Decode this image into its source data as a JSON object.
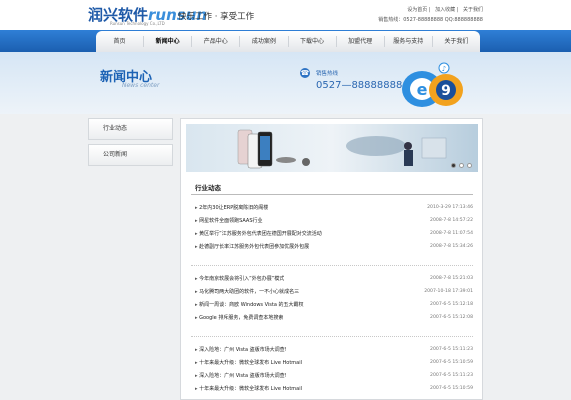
{
  "header": {
    "logo_cn": "润兴软件",
    "logo_en": "runsun",
    "logo_sub": "Runsun Technology Co.,LTD",
    "slogan": "快乐工作 · 享受工作",
    "toplinks": [
      "设为首页",
      "加入收藏",
      "关于我们"
    ],
    "hotline": "销售热线：0527-88888888  QQ:888888888"
  },
  "nav": {
    "items": [
      "首页",
      "新闻中心",
      "产品中心",
      "成功案例",
      "下载中心",
      "加盟代理",
      "服务与支持",
      "关于我们"
    ],
    "active_index": 1
  },
  "banner": {
    "title": "新闻中心",
    "subtitle": "News center",
    "hotline_label": "销售热线",
    "hotline_number": "0527—88888888"
  },
  "sidebar": {
    "items": [
      "行业动态",
      "公司新闻"
    ]
  },
  "main": {
    "section_title": "行业动态",
    "groups": [
      [
        {
          "title": "2年内30让ERP脱离陈旧的阁楼",
          "date": "2010-3-29 17:13:46"
        },
        {
          "title": "网星软件全面领跑SAAS行业",
          "date": "2008-7-8 14:57:22"
        },
        {
          "title": "黄区举行”江苏服务外包代表团在德国开展配对交流活动",
          "date": "2008-7-8 11:07:54"
        },
        {
          "title": "赴德副厅长率江苏服务外包代表团参加优展外包展",
          "date": "2008-7-8 15:34:26"
        }
      ],
      [
        {
          "title": "今年南京软展会将引入”外包办展”模式",
          "date": "2008-7-8 15:21:03"
        },
        {
          "title": "马化腾司两大助团的软件，一不小心就成名三",
          "date": "2007-10-18 17:39:01"
        },
        {
          "title": "新闻一周谈：商欧 Windows Vista 的五大霸权",
          "date": "2007-6-5 15:12:18"
        },
        {
          "title": "Google 排斥服务，免费调查本地搜索",
          "date": "2007-6-5 15:12:08"
        }
      ],
      [
        {
          "title": "深入险地：广州 Vista 盗版市场大调查!",
          "date": "2007-6-5 15:11:23"
        },
        {
          "title": "十年来最大升级：微软全球发布 Live Hotmail",
          "date": "2007-6-5 15:10:59"
        },
        {
          "title": "深入险地：广州 Vista 盗版市场大调查!",
          "date": "2007-6-5 15:11:23"
        },
        {
          "title": "十年来最大升级：微软全球发布 Live Hotmail",
          "date": "2007-6-5 15:10:59"
        }
      ]
    ]
  },
  "colors": {
    "nav_blue": "#1b5fb0",
    "brand_blue": "#1d63b5"
  }
}
